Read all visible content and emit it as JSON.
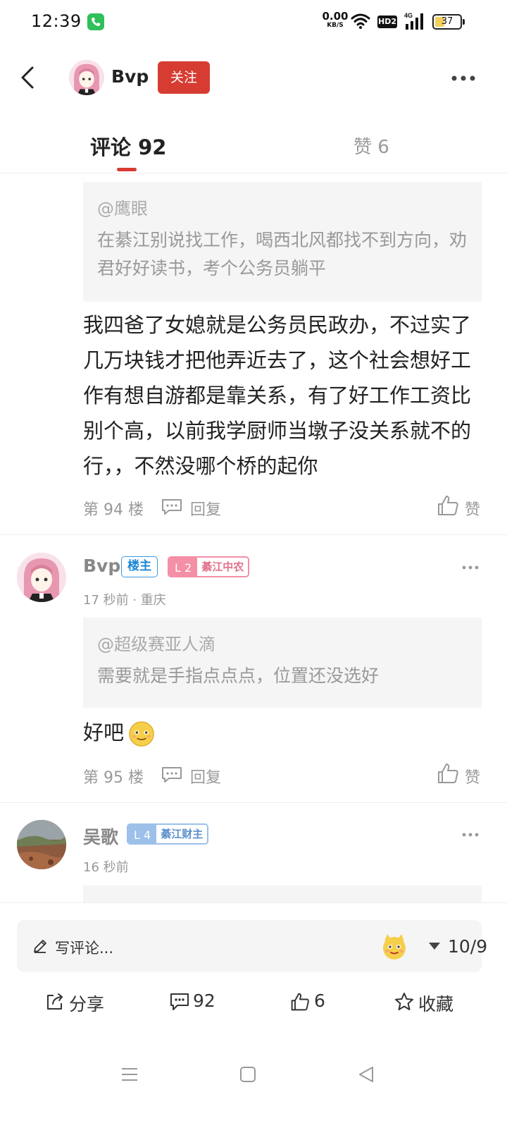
{
  "status_bar": {
    "time": "12:39",
    "net_speed_value": "0.00",
    "net_speed_unit": "KB/S",
    "hd_label": "HD2",
    "battery_level": "37",
    "battery_fraction": 0.37,
    "icons": [
      "phone-call-icon",
      "wifi-icon",
      "hd-icon",
      "signal-4g-icon",
      "battery-icon"
    ]
  },
  "header": {
    "author_name": "Bvp",
    "follow_label": "关注",
    "back_icon": "chevron-left-icon",
    "more_icon": "more-dots-icon"
  },
  "tabs": {
    "comments_label": "评论 92",
    "likes_label": "赞 6",
    "active_color": "#d63c32"
  },
  "comments": [
    {
      "quote_author": "@鹰眼",
      "quote_text": "在綦江别说找工作，喝西北风都找不到方向，劝君好好读书，考个公务员躺平",
      "text": "我四爸了女媳就是公务员民政办，不过实了几万块钱才把他弄近去了，这个社会想好工作有想自游都是靠关系，有了好工作工资比别个高，以前我学厨师当墩子没关系就不的行，，不然没哪个桥的起你",
      "floor": "第 94 楼",
      "reply_label": "回复",
      "like_label": "赞"
    },
    {
      "author": "Bvp",
      "op_badge": "楼主",
      "level": "L 2",
      "level_title": "綦江中农",
      "meta": "17 秒前 · 重庆",
      "quote_author": "@超级赛亚人滴",
      "quote_text": "需要就是手指点点点，位置还没选好",
      "text": "好吧",
      "floor": "第 95 楼",
      "reply_label": "回复",
      "like_label": "赞"
    },
    {
      "author": "吴歌",
      "level": "L 4",
      "level_title": "綦江财主",
      "meta": "16 秒前"
    }
  ],
  "bottom_bar": {
    "input_placeholder": "写评论...",
    "page_indicator": "10/9",
    "share_label": "分享",
    "comment_count": "92",
    "like_count": "6",
    "collect_label": "收藏"
  },
  "colors": {
    "accent": "#d63c32",
    "op_badge": "#1b86d6",
    "level_pink": "#f48fa6",
    "level_blue": "#9cc0ea"
  }
}
